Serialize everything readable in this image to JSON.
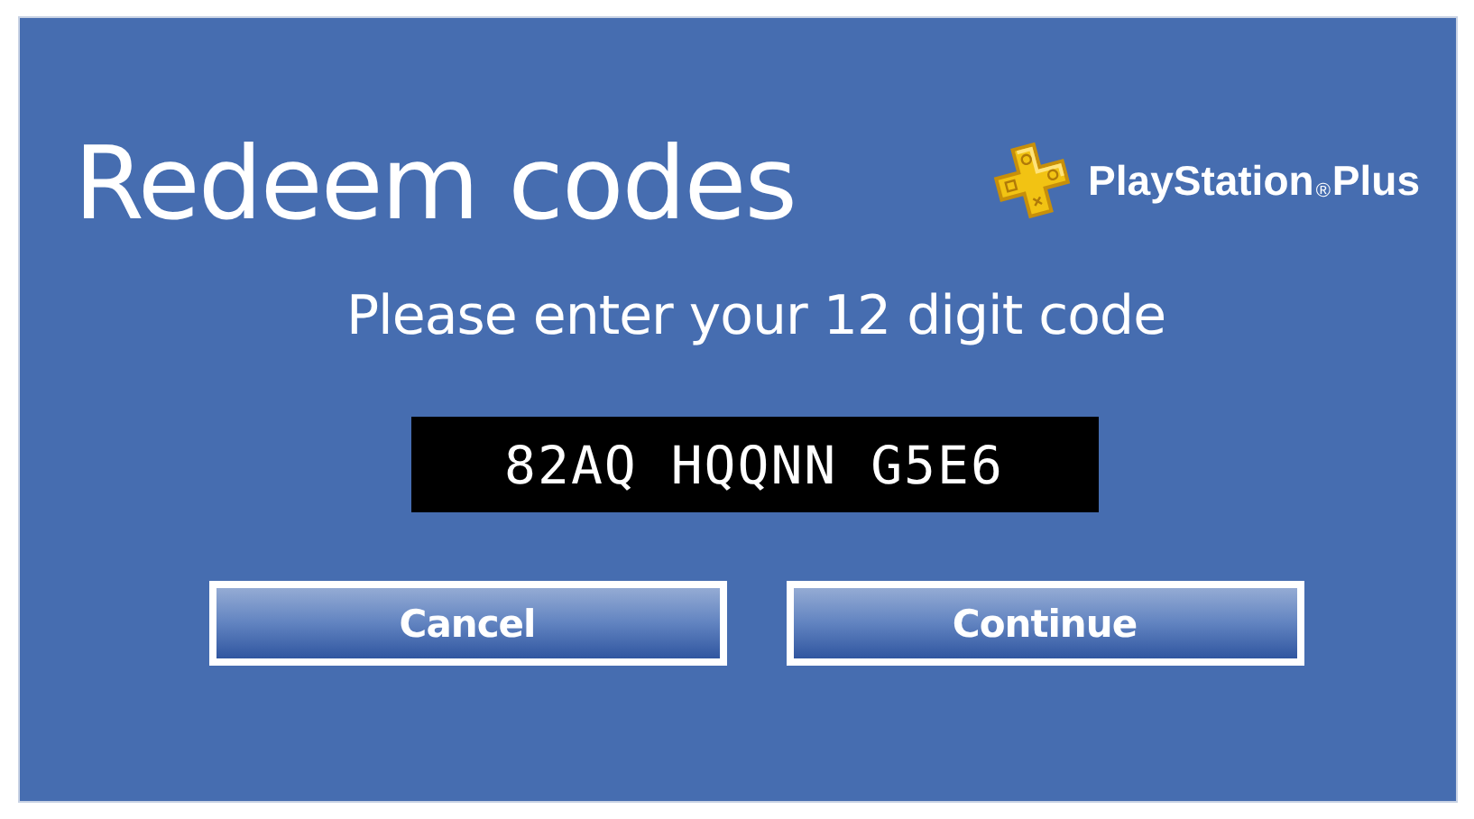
{
  "title": "Redeem codes",
  "brand": {
    "text": "PlayStation$_{®}$Plus"
  },
  "prompt": "Please enter your 12 digit code",
  "code_field": {
    "value": "82AQ HQQNN G5E6"
  },
  "buttons": [
    {
      "label": "Cancel"
    },
    {
      "label": "Continue"
    }
  ]
}
